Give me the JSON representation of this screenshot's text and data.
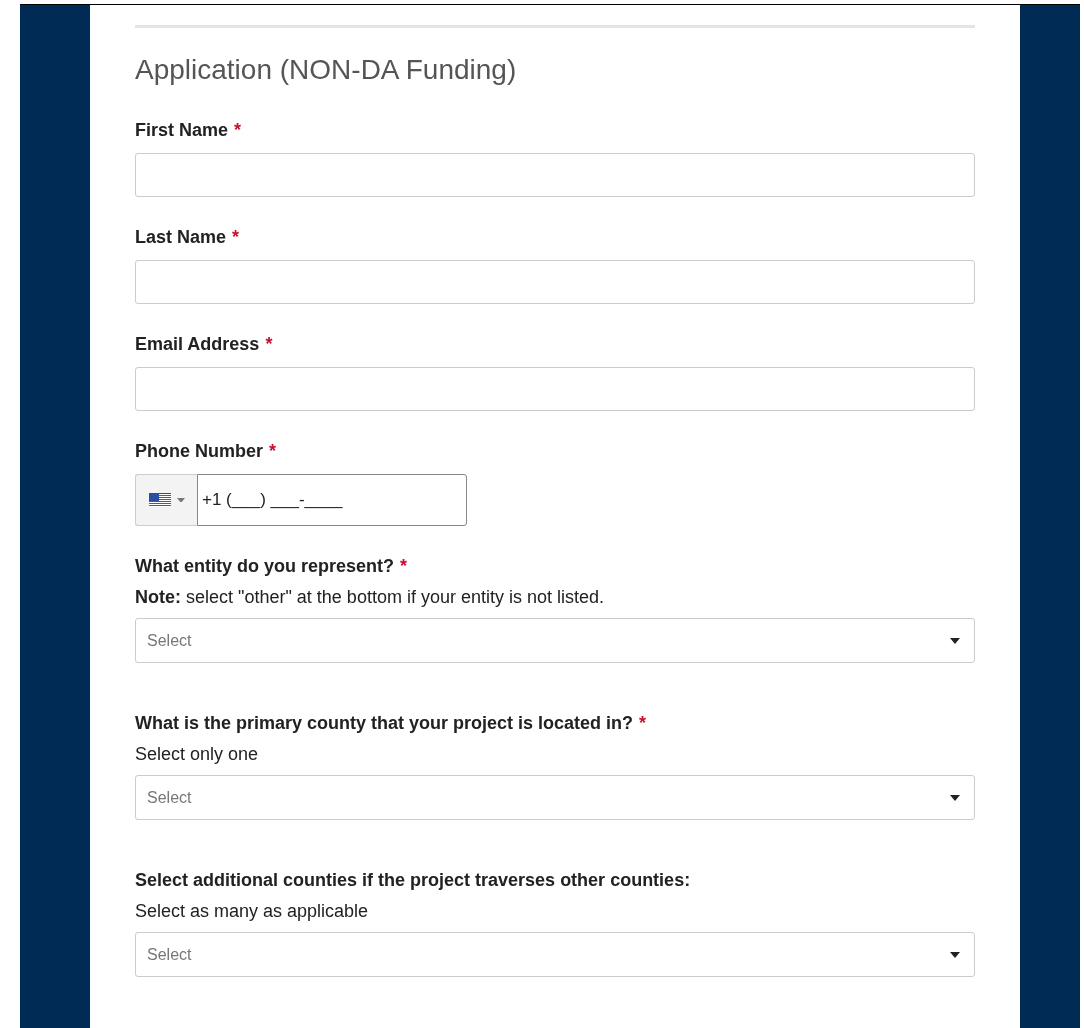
{
  "form": {
    "title": "Application (NON-DA Funding)",
    "fields": [
      {
        "kind": "text",
        "label": "First Name",
        "required_mark": "*"
      },
      {
        "kind": "text",
        "label": "Last Name",
        "required_mark": "*"
      },
      {
        "kind": "text",
        "label": "Email Address",
        "required_mark": "*"
      },
      {
        "kind": "phone",
        "label": "Phone Number",
        "required_mark": "*",
        "value": "+1 (___) ___-____"
      },
      {
        "kind": "select",
        "label": "What entity do you represent?",
        "required_mark": "*",
        "hint": "**Note:** select \"other\" at the bottom if your entity is not listed.",
        "placeholder": "Select"
      },
      {
        "kind": "select",
        "label": "What is the primary county that your project is located in?",
        "required_mark": "*",
        "hint": "Select only one",
        "placeholder": "Select"
      },
      {
        "kind": "select",
        "label": "Select additional counties if the project traverses other counties:",
        "hint": "Select as many as applicable",
        "placeholder": "Select"
      }
    ]
  }
}
